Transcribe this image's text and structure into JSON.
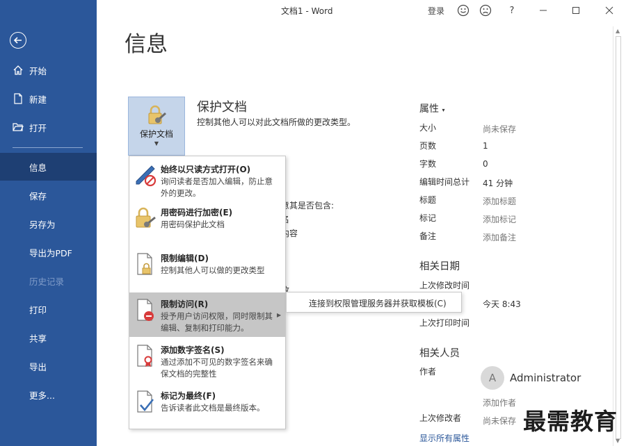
{
  "window": {
    "title": "文档1 - Word",
    "login": "登录",
    "help": "?"
  },
  "sidebar": {
    "items": [
      {
        "label": "开始"
      },
      {
        "label": "新建"
      },
      {
        "label": "打开"
      },
      {
        "label": "信息"
      },
      {
        "label": "保存"
      },
      {
        "label": "另存为"
      },
      {
        "label": "导出为PDF"
      },
      {
        "label": "历史记录"
      },
      {
        "label": "打印"
      },
      {
        "label": "共享"
      },
      {
        "label": "导出"
      },
      {
        "label": "更多..."
      }
    ]
  },
  "page": {
    "title": "信息",
    "protect_button": "保护文档",
    "section_title": "保护文档",
    "section_desc": "控制其他人可以对此文档所做的更改类型。",
    "bg_frag_1": "意其是否包含:",
    "bg_frag_2": "名",
    "bg_frag_3": "内容",
    "bg_frag_4": "改"
  },
  "menu": {
    "items": [
      {
        "title": "始终以只读方式打开(O)",
        "desc": "询问读者是否加入编辑，防止意外的更改。"
      },
      {
        "title": "用密码进行加密(E)",
        "desc": "用密码保护此文档"
      },
      {
        "title": "限制编辑(D)",
        "desc": "控制其他人可以做的更改类型"
      },
      {
        "title": "限制访问(R)",
        "desc": "授予用户访问权限，同时限制其编辑、复制和打印能力。"
      },
      {
        "title": "添加数字签名(S)",
        "desc": "通过添加不可见的数字签名来确保文档的完整性"
      },
      {
        "title": "标记为最终(F)",
        "desc": "告诉读者此文档是最终版本。"
      }
    ],
    "submenu": "连接到权限管理服务器并获取模板(C)"
  },
  "properties": {
    "header": "属性",
    "rows": [
      {
        "label": "大小",
        "value": "尚未保存"
      },
      {
        "label": "页数",
        "value": "1"
      },
      {
        "label": "字数",
        "value": "0"
      },
      {
        "label": "编辑时间总计",
        "value": "41 分钟"
      },
      {
        "label": "标题",
        "value": "添加标题"
      },
      {
        "label": "标记",
        "value": "添加标记"
      },
      {
        "label": "备注",
        "value": "添加备注"
      }
    ],
    "dates_header": "相关日期",
    "last_modified_label": "上次修改时间",
    "created_value": "今天 8:43",
    "last_printed_label": "上次打印时间",
    "people_header": "相关人员",
    "author_label": "作者",
    "author_initial": "A",
    "author_name": "Administrator",
    "add_author": "添加作者",
    "last_modified_by_label": "上次修改者",
    "last_modified_by_value": "尚未保存",
    "show_all": "显示所有属性"
  },
  "watermark": "最需教育",
  "colors": {
    "sidebar": "#2b579a",
    "sidebar_active": "#1e3f73",
    "protect_bg": "#c5d5ea",
    "menu_highlight": "#c6c6c6",
    "link": "#2b579a"
  }
}
